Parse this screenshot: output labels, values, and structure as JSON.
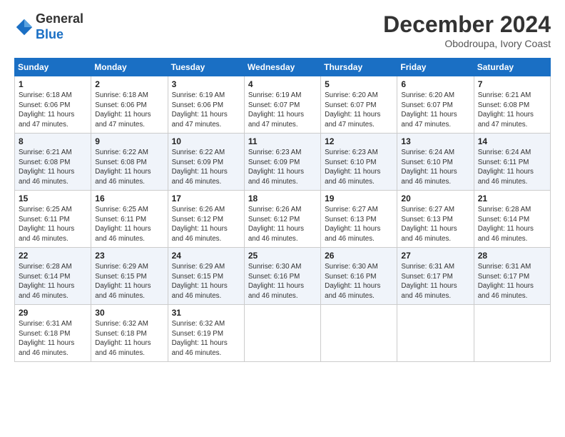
{
  "header": {
    "logo_general": "General",
    "logo_blue": "Blue",
    "month_title": "December 2024",
    "location": "Obodroupa, Ivory Coast"
  },
  "weekdays": [
    "Sunday",
    "Monday",
    "Tuesday",
    "Wednesday",
    "Thursday",
    "Friday",
    "Saturday"
  ],
  "weeks": [
    [
      {
        "day": "1",
        "info": "Sunrise: 6:18 AM\nSunset: 6:06 PM\nDaylight: 11 hours\nand 47 minutes."
      },
      {
        "day": "2",
        "info": "Sunrise: 6:18 AM\nSunset: 6:06 PM\nDaylight: 11 hours\nand 47 minutes."
      },
      {
        "day": "3",
        "info": "Sunrise: 6:19 AM\nSunset: 6:06 PM\nDaylight: 11 hours\nand 47 minutes."
      },
      {
        "day": "4",
        "info": "Sunrise: 6:19 AM\nSunset: 6:07 PM\nDaylight: 11 hours\nand 47 minutes."
      },
      {
        "day": "5",
        "info": "Sunrise: 6:20 AM\nSunset: 6:07 PM\nDaylight: 11 hours\nand 47 minutes."
      },
      {
        "day": "6",
        "info": "Sunrise: 6:20 AM\nSunset: 6:07 PM\nDaylight: 11 hours\nand 47 minutes."
      },
      {
        "day": "7",
        "info": "Sunrise: 6:21 AM\nSunset: 6:08 PM\nDaylight: 11 hours\nand 47 minutes."
      }
    ],
    [
      {
        "day": "8",
        "info": "Sunrise: 6:21 AM\nSunset: 6:08 PM\nDaylight: 11 hours\nand 46 minutes."
      },
      {
        "day": "9",
        "info": "Sunrise: 6:22 AM\nSunset: 6:08 PM\nDaylight: 11 hours\nand 46 minutes."
      },
      {
        "day": "10",
        "info": "Sunrise: 6:22 AM\nSunset: 6:09 PM\nDaylight: 11 hours\nand 46 minutes."
      },
      {
        "day": "11",
        "info": "Sunrise: 6:23 AM\nSunset: 6:09 PM\nDaylight: 11 hours\nand 46 minutes."
      },
      {
        "day": "12",
        "info": "Sunrise: 6:23 AM\nSunset: 6:10 PM\nDaylight: 11 hours\nand 46 minutes."
      },
      {
        "day": "13",
        "info": "Sunrise: 6:24 AM\nSunset: 6:10 PM\nDaylight: 11 hours\nand 46 minutes."
      },
      {
        "day": "14",
        "info": "Sunrise: 6:24 AM\nSunset: 6:11 PM\nDaylight: 11 hours\nand 46 minutes."
      }
    ],
    [
      {
        "day": "15",
        "info": "Sunrise: 6:25 AM\nSunset: 6:11 PM\nDaylight: 11 hours\nand 46 minutes."
      },
      {
        "day": "16",
        "info": "Sunrise: 6:25 AM\nSunset: 6:11 PM\nDaylight: 11 hours\nand 46 minutes."
      },
      {
        "day": "17",
        "info": "Sunrise: 6:26 AM\nSunset: 6:12 PM\nDaylight: 11 hours\nand 46 minutes."
      },
      {
        "day": "18",
        "info": "Sunrise: 6:26 AM\nSunset: 6:12 PM\nDaylight: 11 hours\nand 46 minutes."
      },
      {
        "day": "19",
        "info": "Sunrise: 6:27 AM\nSunset: 6:13 PM\nDaylight: 11 hours\nand 46 minutes."
      },
      {
        "day": "20",
        "info": "Sunrise: 6:27 AM\nSunset: 6:13 PM\nDaylight: 11 hours\nand 46 minutes."
      },
      {
        "day": "21",
        "info": "Sunrise: 6:28 AM\nSunset: 6:14 PM\nDaylight: 11 hours\nand 46 minutes."
      }
    ],
    [
      {
        "day": "22",
        "info": "Sunrise: 6:28 AM\nSunset: 6:14 PM\nDaylight: 11 hours\nand 46 minutes."
      },
      {
        "day": "23",
        "info": "Sunrise: 6:29 AM\nSunset: 6:15 PM\nDaylight: 11 hours\nand 46 minutes."
      },
      {
        "day": "24",
        "info": "Sunrise: 6:29 AM\nSunset: 6:15 PM\nDaylight: 11 hours\nand 46 minutes."
      },
      {
        "day": "25",
        "info": "Sunrise: 6:30 AM\nSunset: 6:16 PM\nDaylight: 11 hours\nand 46 minutes."
      },
      {
        "day": "26",
        "info": "Sunrise: 6:30 AM\nSunset: 6:16 PM\nDaylight: 11 hours\nand 46 minutes."
      },
      {
        "day": "27",
        "info": "Sunrise: 6:31 AM\nSunset: 6:17 PM\nDaylight: 11 hours\nand 46 minutes."
      },
      {
        "day": "28",
        "info": "Sunrise: 6:31 AM\nSunset: 6:17 PM\nDaylight: 11 hours\nand 46 minutes."
      }
    ],
    [
      {
        "day": "29",
        "info": "Sunrise: 6:31 AM\nSunset: 6:18 PM\nDaylight: 11 hours\nand 46 minutes."
      },
      {
        "day": "30",
        "info": "Sunrise: 6:32 AM\nSunset: 6:18 PM\nDaylight: 11 hours\nand 46 minutes."
      },
      {
        "day": "31",
        "info": "Sunrise: 6:32 AM\nSunset: 6:19 PM\nDaylight: 11 hours\nand 46 minutes."
      },
      {
        "day": "",
        "info": ""
      },
      {
        "day": "",
        "info": ""
      },
      {
        "day": "",
        "info": ""
      },
      {
        "day": "",
        "info": ""
      }
    ]
  ]
}
